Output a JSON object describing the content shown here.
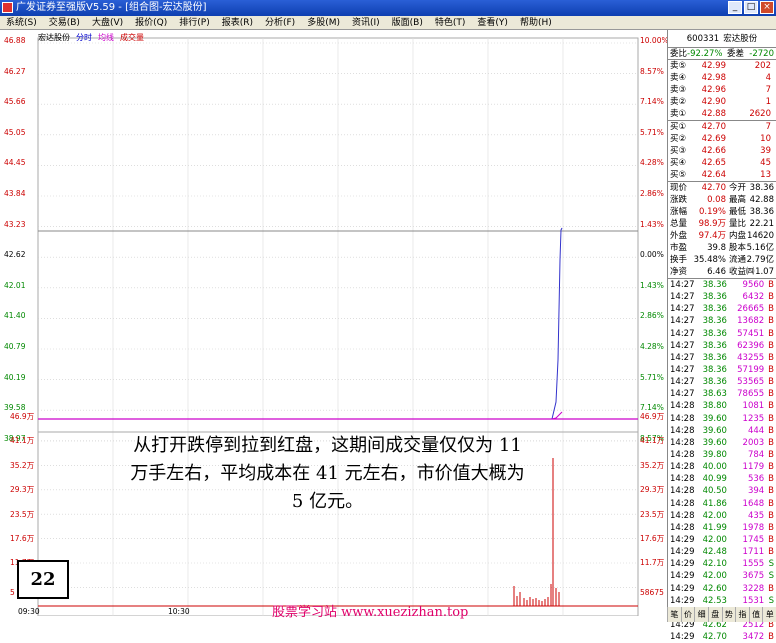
{
  "window": {
    "title": "广发证券至强版V5.59 - [组合图-宏达股份]",
    "buttons": [
      "_",
      "□",
      "×"
    ]
  },
  "menu": [
    "系统(S)",
    "交易(B)",
    "大盘(V)",
    "报价(Q)",
    "排行(P)",
    "报表(R)",
    "分析(F)",
    "多股(M)",
    "资讯(I)",
    "版面(B)",
    "特色(T)",
    "查看(Y)",
    "帮助(H)"
  ],
  "chart": {
    "legend": {
      "name": "宏达股份",
      "mode": "分时",
      "avg": "均线",
      "vol": "成交量"
    },
    "price_labels": [
      "46.88",
      "46.27",
      "45.66",
      "45.05",
      "44.45",
      "43.84",
      "43.23",
      "42.62",
      "42.01",
      "41.40",
      "40.79",
      "40.19",
      "39.58",
      "38.97"
    ],
    "pct_labels": [
      "10.00%",
      "8.57%",
      "7.14%",
      "5.71%",
      "4.28%",
      "2.86%",
      "1.43%",
      "0.00%",
      "1.43%",
      "2.86%",
      "4.28%",
      "5.71%",
      "7.14%",
      "8.57%"
    ],
    "vol_left": [
      "46.9万",
      "41.1万",
      "35.2万",
      "29.3万",
      "23.5万",
      "17.6万",
      "11.7万",
      "5"
    ],
    "vol_right": [
      "46.9万",
      "41.1万",
      "35.2万",
      "29.3万",
      "23.5万",
      "17.6万",
      "11.7万",
      "58675"
    ],
    "time_labels": [
      "09:30",
      "10:30"
    ],
    "note": "从打开跌停到拉到红盘，这期间成交量仅仅为 11 万手左右，平均成本在 41 元左右，市价值大概为 5 亿元。",
    "badge": "22",
    "site": "股票学习站   www.xuezizhan.top"
  },
  "panel": {
    "code": "600331",
    "name": "宏达股份",
    "weibi": {
      "l": "委比",
      "v": "-92.27%",
      "l2": "委差",
      "v2": "-2720"
    },
    "asks": [
      {
        "l": "卖⑤",
        "p": "42.99",
        "v": "202"
      },
      {
        "l": "卖④",
        "p": "42.98",
        "v": "4"
      },
      {
        "l": "卖③",
        "p": "42.96",
        "v": "7"
      },
      {
        "l": "卖②",
        "p": "42.90",
        "v": "1"
      },
      {
        "l": "卖①",
        "p": "42.88",
        "v": "2620"
      }
    ],
    "bids": [
      {
        "l": "买①",
        "p": "42.70",
        "v": "7"
      },
      {
        "l": "买②",
        "p": "42.69",
        "v": "10"
      },
      {
        "l": "买③",
        "p": "42.66",
        "v": "39"
      },
      {
        "l": "买④",
        "p": "42.65",
        "v": "45"
      },
      {
        "l": "买⑤",
        "p": "42.64",
        "v": "13"
      }
    ],
    "quote": [
      [
        "现价",
        "42.70",
        "今开",
        "38.36"
      ],
      [
        "涨跌",
        "0.08",
        "最高",
        "42.88"
      ],
      [
        "涨幅",
        "0.19%",
        "最低",
        "38.36"
      ],
      [
        "总量",
        "98.9万",
        "量比",
        "22.21"
      ],
      [
        "外盘",
        "97.4万",
        "内盘",
        "14620"
      ],
      [
        "市盈",
        "39.8",
        "股本",
        "5.16亿"
      ],
      [
        "换手",
        "35.48%",
        "流通",
        "2.79亿"
      ],
      [
        "净资",
        "6.46",
        "收益㈣",
        "1.07"
      ]
    ],
    "ticks": [
      [
        "14:27",
        "38.36",
        "9560",
        "B"
      ],
      [
        "14:27",
        "38.36",
        "6432",
        "B"
      ],
      [
        "14:27",
        "38.36",
        "26665",
        "B"
      ],
      [
        "14:27",
        "38.36",
        "13682",
        "B"
      ],
      [
        "14:27",
        "38.36",
        "57451",
        "B"
      ],
      [
        "14:27",
        "38.36",
        "62396",
        "B"
      ],
      [
        "14:27",
        "38.36",
        "43255",
        "B"
      ],
      [
        "14:27",
        "38.36",
        "57199",
        "B"
      ],
      [
        "14:27",
        "38.36",
        "53565",
        "B"
      ],
      [
        "14:27",
        "38.63",
        "78655",
        "B"
      ],
      [
        "14:28",
        "38.80",
        "1081",
        "B"
      ],
      [
        "14:28",
        "39.60",
        "1235",
        "B"
      ],
      [
        "14:28",
        "39.60",
        "444",
        "B"
      ],
      [
        "14:28",
        "39.60",
        "2003",
        "B"
      ],
      [
        "14:28",
        "39.80",
        "784",
        "B"
      ],
      [
        "14:28",
        "40.00",
        "1179",
        "B"
      ],
      [
        "14:28",
        "40.99",
        "536",
        "B"
      ],
      [
        "14:28",
        "40.50",
        "394",
        "B"
      ],
      [
        "14:28",
        "41.86",
        "1648",
        "B"
      ],
      [
        "14:28",
        "42.00",
        "435",
        "B"
      ],
      [
        "14:28",
        "41.99",
        "1978",
        "B"
      ],
      [
        "14:29",
        "42.00",
        "1745",
        "B"
      ],
      [
        "14:29",
        "42.48",
        "1711",
        "B"
      ],
      [
        "14:29",
        "42.10",
        "1555",
        "S"
      ],
      [
        "14:29",
        "42.00",
        "3675",
        "S"
      ],
      [
        "14:29",
        "42.60",
        "3228",
        "B"
      ],
      [
        "14:29",
        "42.53",
        "1531",
        "S"
      ],
      [
        "14:29",
        "42.50",
        "4882",
        "S"
      ],
      [
        "14:29",
        "42.62",
        "2512",
        "B"
      ],
      [
        "14:29",
        "42.70",
        "3472",
        "B"
      ]
    ],
    "tabs": [
      "笔",
      "价",
      "细",
      "盘",
      "势",
      "指",
      "值",
      "单"
    ]
  }
}
